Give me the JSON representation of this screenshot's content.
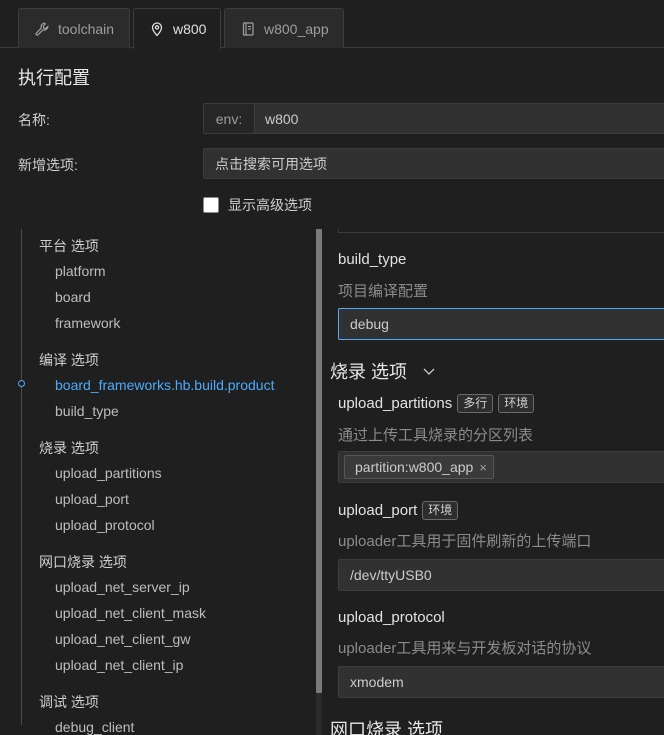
{
  "tabs": [
    {
      "label": "toolchain",
      "icon": "wrench-icon"
    },
    {
      "label": "w800",
      "icon": "location-pin-icon"
    },
    {
      "label": "w800_app",
      "icon": "notebook-icon"
    }
  ],
  "config": {
    "title": "执行配置",
    "name_label": "名称:",
    "env_prefix": "env:",
    "env_value": "w800",
    "add_option_label": "新增选项:",
    "add_option_placeholder": "点击搜索可用选项",
    "show_advanced_label": "显示高级选项"
  },
  "nav": {
    "groups": [
      {
        "label": "平台 选项",
        "items": [
          "platform",
          "board",
          "framework"
        ]
      },
      {
        "label": "编译 选项",
        "items": [
          "board_frameworks.hb.build.product",
          "build_type"
        ]
      },
      {
        "label": "烧录 选项",
        "items": [
          "upload_partitions",
          "upload_port",
          "upload_protocol"
        ]
      },
      {
        "label": "网口烧录 选项",
        "items": [
          "upload_net_server_ip",
          "upload_net_client_mask",
          "upload_net_client_gw",
          "upload_net_client_ip"
        ]
      },
      {
        "label": "调试 选项",
        "items": [
          "debug_client"
        ]
      }
    ],
    "active_item": "board_frameworks.hb.build.product"
  },
  "main": {
    "build_type": {
      "title": "build_type",
      "desc": "项目编译配置",
      "value": "debug"
    },
    "upload_group_title": "烧录 选项",
    "upload_partitions": {
      "title": "upload_partitions",
      "badges": [
        "多行",
        "环境"
      ],
      "desc": "通过上传工具烧录的分区列表",
      "tag": "partition:w800_app",
      "tag_close": "×"
    },
    "upload_port": {
      "title": "upload_port",
      "badges": [
        "环境"
      ],
      "desc": "uploader工具用于固件刷新的上传端口",
      "value": "/dev/ttyUSB0"
    },
    "upload_protocol": {
      "title": "upload_protocol",
      "desc": "uploader工具用来与开发板对话的协议",
      "value": "xmodem"
    },
    "net_group_title": "网口烧录 选项"
  },
  "colors": {
    "accent": "#4daafc",
    "background": "#1f1f1f",
    "input_bg": "#313131"
  }
}
